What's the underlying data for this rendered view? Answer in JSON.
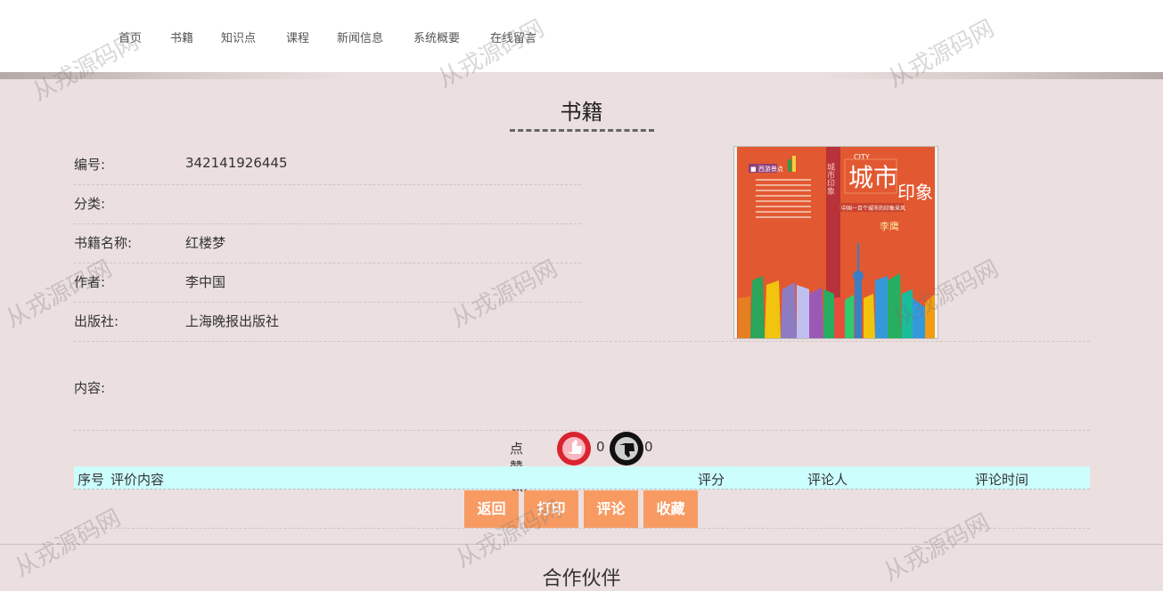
{
  "nav": [
    "首页",
    "书籍",
    "知识点",
    "课程",
    "新闻信息",
    "系统概要",
    "在线留言"
  ],
  "page_title": "书籍",
  "fields": [
    {
      "label": "编号:",
      "value": "342141926445"
    },
    {
      "label": "分类:",
      "value": ""
    },
    {
      "label": "书籍名称:",
      "value": "红楼梦"
    },
    {
      "label": "作者:",
      "value": "李中国"
    },
    {
      "label": "出版社:",
      "value": "上海晚报出版社"
    }
  ],
  "cover": {
    "title": "城市",
    "title2": "印象",
    "city": "CITY",
    "side": "城市印象",
    "subtitle": "中国一百个城市的印象采风",
    "author": "李鹰",
    "tag": "■ 西游景点"
  },
  "content": {
    "label": "内容:",
    "value": ""
  },
  "likes": {
    "label": "点赞数:",
    "up": "0",
    "down": "0"
  },
  "comments_header": {
    "index": "序号",
    "content": "评价内容",
    "score": "评分",
    "user": "评论人",
    "time": "评论时间"
  },
  "buttons": [
    "返回",
    "打印",
    "评论",
    "收藏"
  ],
  "partners_title": "合作伙伴",
  "watermark": "从戎源码网",
  "colors": {
    "page_bg": "#ebdfdf",
    "button": "#f79b63",
    "comment_header": "#ccfefe",
    "cover": "#e25831"
  }
}
